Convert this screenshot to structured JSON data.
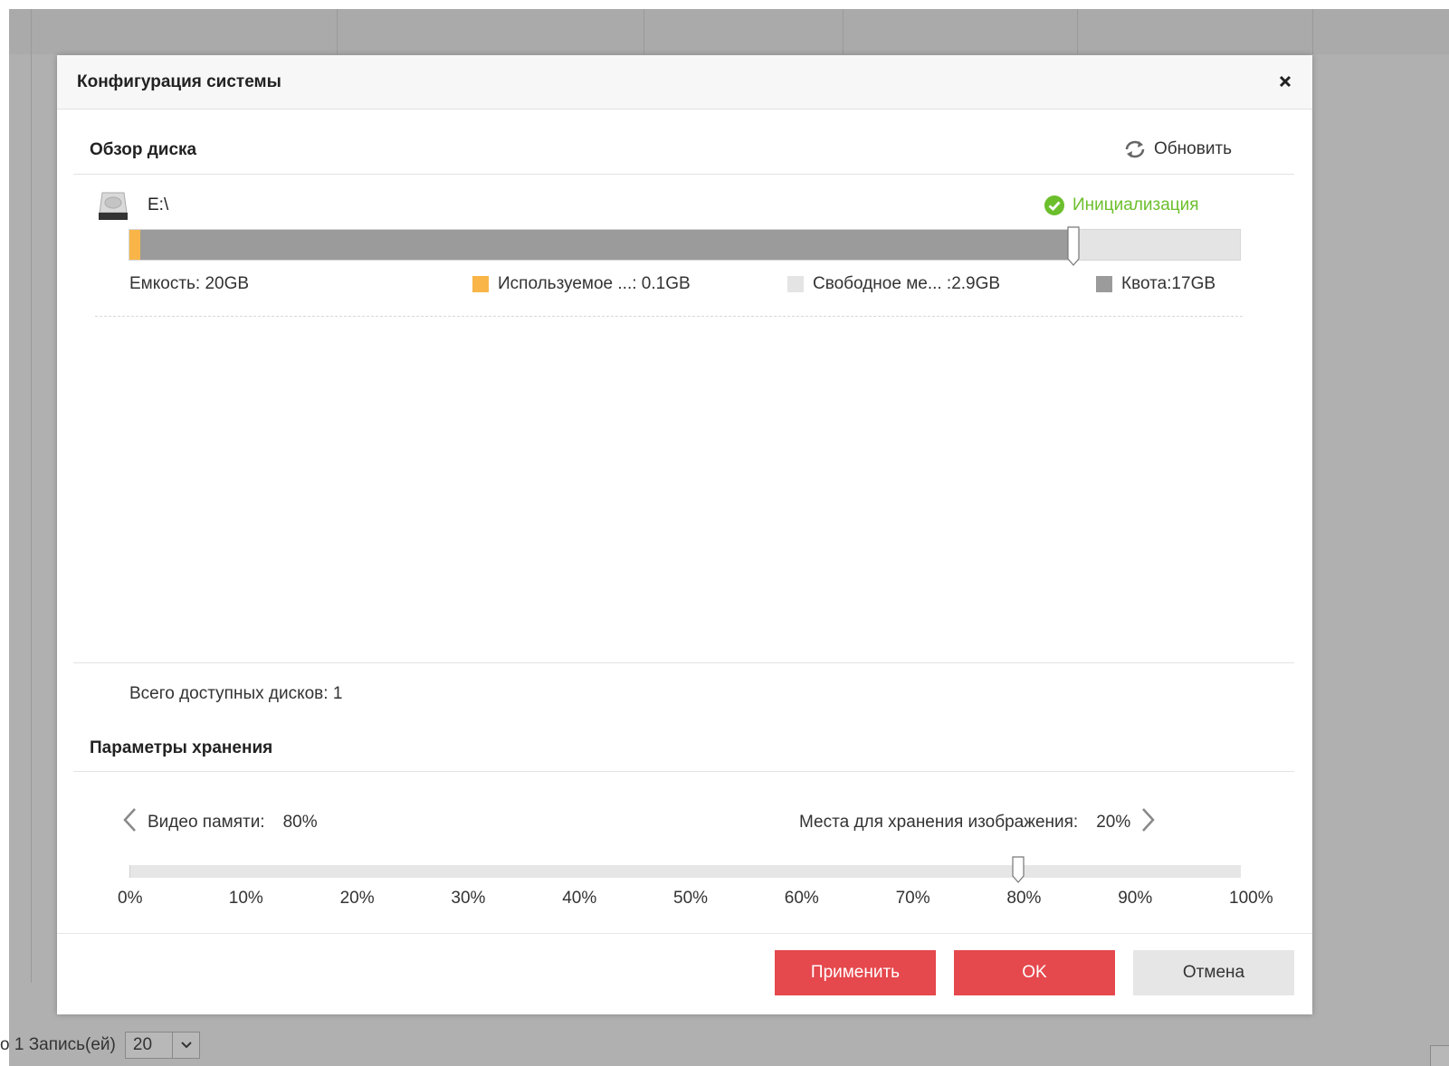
{
  "dialog": {
    "title": "Конфигурация системы",
    "close_icon": "close-icon",
    "apply_label": "Применить",
    "ok_label": "OK",
    "cancel_label": "Отмена"
  },
  "disk_overview": {
    "title": "Обзор диска",
    "refresh_label": "Обновить",
    "disk": {
      "name": "E:\\",
      "status": "Инициализация",
      "capacity_label": "Емкость: 20GB",
      "used_label": "Используемое ...: 0.1GB",
      "free_label": "Свободное ме... :2.9GB",
      "quota_label": "Квота:17GB",
      "used_fraction": 0.01,
      "quota_fraction": 0.85
    },
    "total_disks": "Всего доступных дисков: 1"
  },
  "storage": {
    "title": "Параметры хранения",
    "video_label": "Видео памяти:",
    "video_value": "80%",
    "image_label": "Места для хранения изображения:",
    "image_value": "20%",
    "slider_value": 80,
    "ticks": [
      "0%",
      "10%",
      "20%",
      "30%",
      "40%",
      "50%",
      "60%",
      "70%",
      "80%",
      "90%",
      "100%"
    ]
  },
  "background": {
    "footer_text": "о 1 Запись(ей)",
    "page_size": "20"
  },
  "colors": {
    "used": "#f9b548",
    "free": "#e4e4e4",
    "quota": "#9b9b9b",
    "status_ok": "#6cbf2c",
    "primary": "#e5484d"
  }
}
